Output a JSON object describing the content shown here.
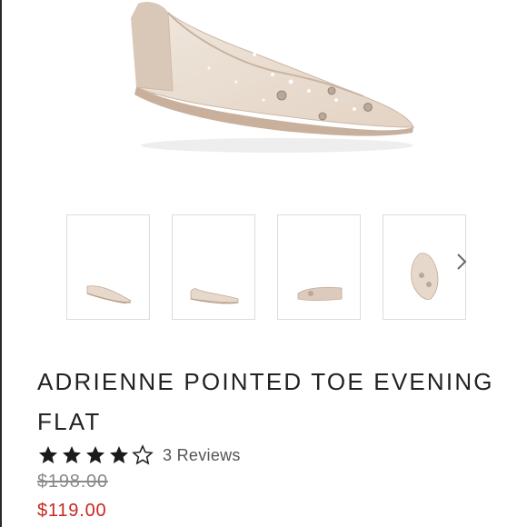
{
  "product": {
    "title": "ADRIENNE POINTED TOE EVENING FLAT",
    "rating": 4,
    "rating_max": 5,
    "reviews_label": "3 Reviews",
    "original_price": "$198.00",
    "sale_price": "$119.00"
  },
  "gallery": {
    "main_image": "shoe-side-view",
    "thumbnails": [
      "shoe-angle-view",
      "shoe-side-view",
      "shoe-heel-view",
      "shoe-top-view"
    ],
    "next_icon": "chevron-right-icon"
  },
  "colors": {
    "sale": "#c8281e",
    "original_price": "#8a8a8a",
    "title": "#222222",
    "star": "#1a1a1a",
    "shoe": "#e6d9cc"
  }
}
